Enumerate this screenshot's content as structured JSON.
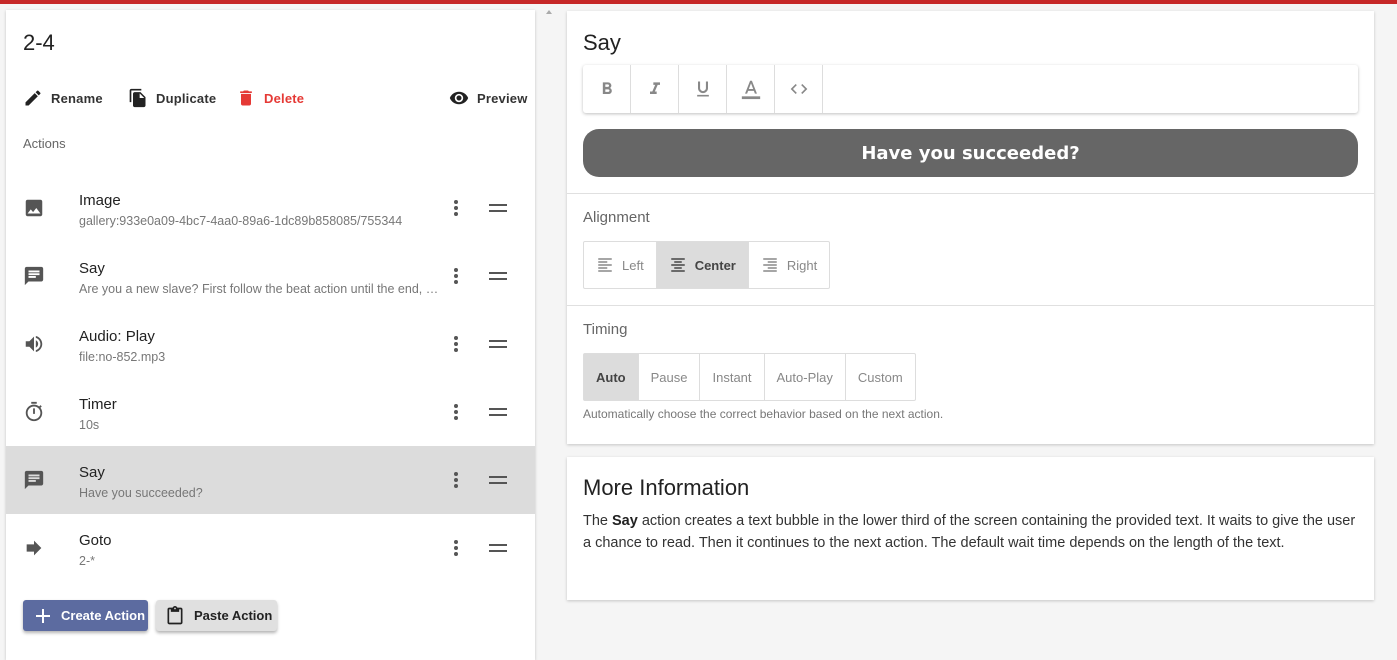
{
  "left": {
    "title": "2-4",
    "toolbar": {
      "rename": "Rename",
      "duplicate": "Duplicate",
      "delete": "Delete",
      "preview": "Preview"
    },
    "actions_label": "Actions",
    "actions": [
      {
        "icon": "image-icon",
        "title": "Image",
        "sub": "gallery:933e0a09-4bc7-4aa0-89a6-1dc89b858085/755344"
      },
      {
        "icon": "chat-icon",
        "title": "Say",
        "sub": "Are you a new slave? First follow the beat action until the end, then read the rest."
      },
      {
        "icon": "speaker-icon",
        "title": "Audio: Play",
        "sub": "file:no-852.mp3"
      },
      {
        "icon": "timer-icon",
        "title": "Timer",
        "sub": "10s"
      },
      {
        "icon": "chat-icon",
        "title": "Say",
        "sub": "Have you succeeded?"
      },
      {
        "icon": "arrow-right-icon",
        "title": "Goto",
        "sub": "2-*"
      }
    ],
    "selected_index": 4,
    "create_action": "Create Action",
    "paste_action": "Paste Action"
  },
  "editor": {
    "title": "Say",
    "bubble_text": "Have you succeeded?",
    "alignment_label": "Alignment",
    "alignment_options": [
      "Left",
      "Center",
      "Right"
    ],
    "alignment_selected": "Center",
    "timing_label": "Timing",
    "timing_options": [
      "Auto",
      "Pause",
      "Instant",
      "Auto-Play",
      "Custom"
    ],
    "timing_selected": "Auto",
    "timing_hint": "Automatically choose the correct behavior based on the next action."
  },
  "info": {
    "title": "More Information",
    "text_prefix": "The ",
    "text_bold": "Say",
    "text_rest": " action creates a text bubble in the lower third of the screen containing the provided text. It waits to give the user a chance to read. Then it continues to the next action. The default wait time depends on the length of the text."
  },
  "colors": {
    "accent_bar": "#c62828",
    "delete": "#e53935",
    "create_button": "#5c6ba0",
    "bubble": "#666666",
    "selected_row": "#dcdcdc"
  }
}
